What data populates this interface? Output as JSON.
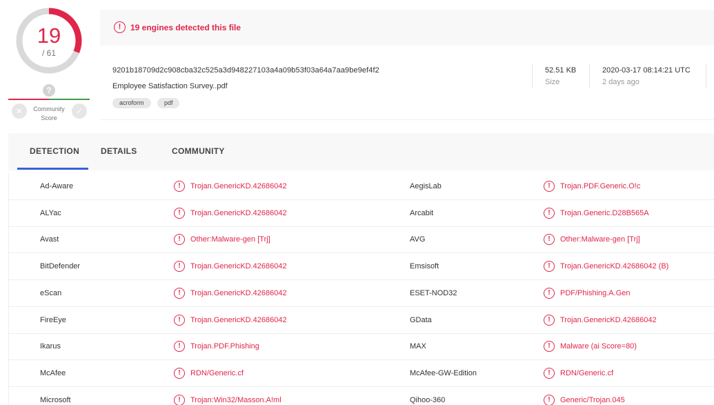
{
  "score": {
    "detected": "19",
    "total": "/ 61",
    "ratio": 0.3115,
    "color": "#e0254a"
  },
  "community": {
    "question": "?",
    "label_line1": "Community",
    "label_line2": "Score",
    "left_color": "#e0254a",
    "right_color": "#3f9a4a"
  },
  "alert": {
    "text": "19 engines detected this file"
  },
  "file": {
    "hash": "9201b18709d2c908cba32c525a3d948227103a4a09b53f03a64a7aa9be9ef4f2",
    "name": "Employee Satisfaction Survey..pdf",
    "tags": [
      "acroform",
      "pdf"
    ],
    "size": "52.51 KB",
    "size_label": "Size",
    "date": "2020-03-17 08:14:21 UTC",
    "date_relative": "2 days ago"
  },
  "tabs": [
    {
      "label": "DETECTION",
      "active": true
    },
    {
      "label": "DETAILS",
      "active": false
    },
    {
      "label": "COMMUNITY",
      "active": false
    }
  ],
  "accent_color": "#3b61d8",
  "detections": [
    {
      "left_engine": "Ad-Aware",
      "left_result": "Trojan.GenericKD.42686042",
      "right_engine": "AegisLab",
      "right_result": "Trojan.PDF.Generic.O!c"
    },
    {
      "left_engine": "ALYac",
      "left_result": "Trojan.GenericKD.42686042",
      "right_engine": "Arcabit",
      "right_result": "Trojan.Generic.D28B565A"
    },
    {
      "left_engine": "Avast",
      "left_result": "Other:Malware-gen [Trj]",
      "right_engine": "AVG",
      "right_result": "Other:Malware-gen [Trj]"
    },
    {
      "left_engine": "BitDefender",
      "left_result": "Trojan.GenericKD.42686042",
      "right_engine": "Emsisoft",
      "right_result": "Trojan.GenericKD.42686042 (B)"
    },
    {
      "left_engine": "eScan",
      "left_result": "Trojan.GenericKD.42686042",
      "right_engine": "ESET-NOD32",
      "right_result": "PDF/Phishing.A.Gen"
    },
    {
      "left_engine": "FireEye",
      "left_result": "Trojan.GenericKD.42686042",
      "right_engine": "GData",
      "right_result": "Trojan.GenericKD.42686042"
    },
    {
      "left_engine": "Ikarus",
      "left_result": "Trojan.PDF.Phishing",
      "right_engine": "MAX",
      "right_result": "Malware (ai Score=80)"
    },
    {
      "left_engine": "McAfee",
      "left_result": "RDN/Generic.cf",
      "right_engine": "McAfee-GW-Edition",
      "right_result": "RDN/Generic.cf"
    },
    {
      "left_engine": "Microsoft",
      "left_result": "Trojan:Win32/Masson.A!ml",
      "right_engine": "Qihoo-360",
      "right_result": "Generic/Trojan.045"
    }
  ],
  "icons": {
    "alert": "alert-circle-icon",
    "close": "close-icon",
    "check": "check-icon",
    "help": "help-icon"
  }
}
